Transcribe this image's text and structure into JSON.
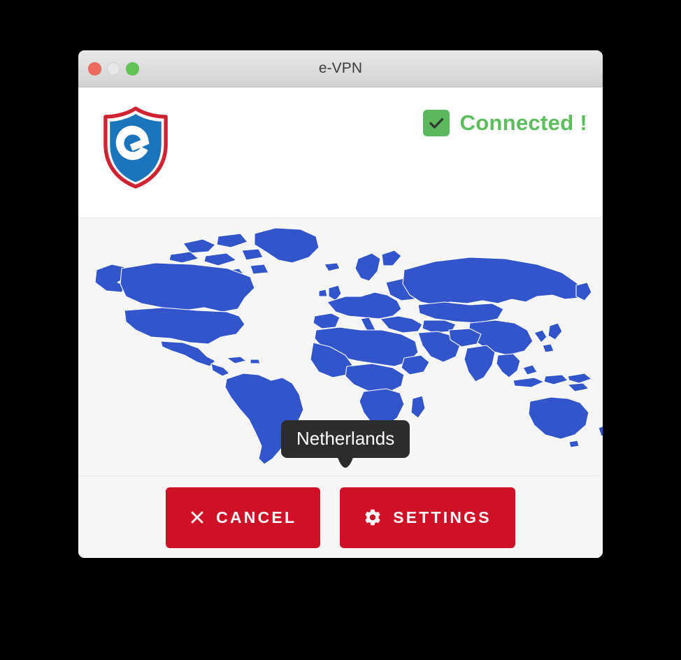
{
  "window": {
    "title": "e-VPN",
    "traffic_lights": [
      {
        "name": "close",
        "color": "#ee6a5f"
      },
      {
        "name": "minimize",
        "color": "#e7e7e7"
      },
      {
        "name": "maximize",
        "color": "#61c454"
      }
    ]
  },
  "header": {
    "logo_icon": "shield-e-logo",
    "logo_colors": {
      "shield_outline": "#cf2233",
      "shield_fill": "#1b75bc",
      "letter": "#ffffff"
    },
    "status": {
      "icon": "check-icon",
      "label": "Connected !",
      "color": "#5cbd5c",
      "badge_color": "#5cb85c"
    }
  },
  "map": {
    "tooltip": {
      "label": "Netherlands",
      "background": "#2c2c2c",
      "text_color": "#ffffff"
    },
    "land_color": "#3355cc",
    "background_color": "#f6f6f6",
    "border_color": "#ffffff"
  },
  "footer": {
    "buttons": [
      {
        "name": "cancel",
        "icon": "close-x-icon",
        "label": "CANCEL",
        "color": "#ce1126"
      },
      {
        "name": "settings",
        "icon": "gear-icon",
        "label": "SETTINGS",
        "color": "#ce1126"
      }
    ]
  }
}
